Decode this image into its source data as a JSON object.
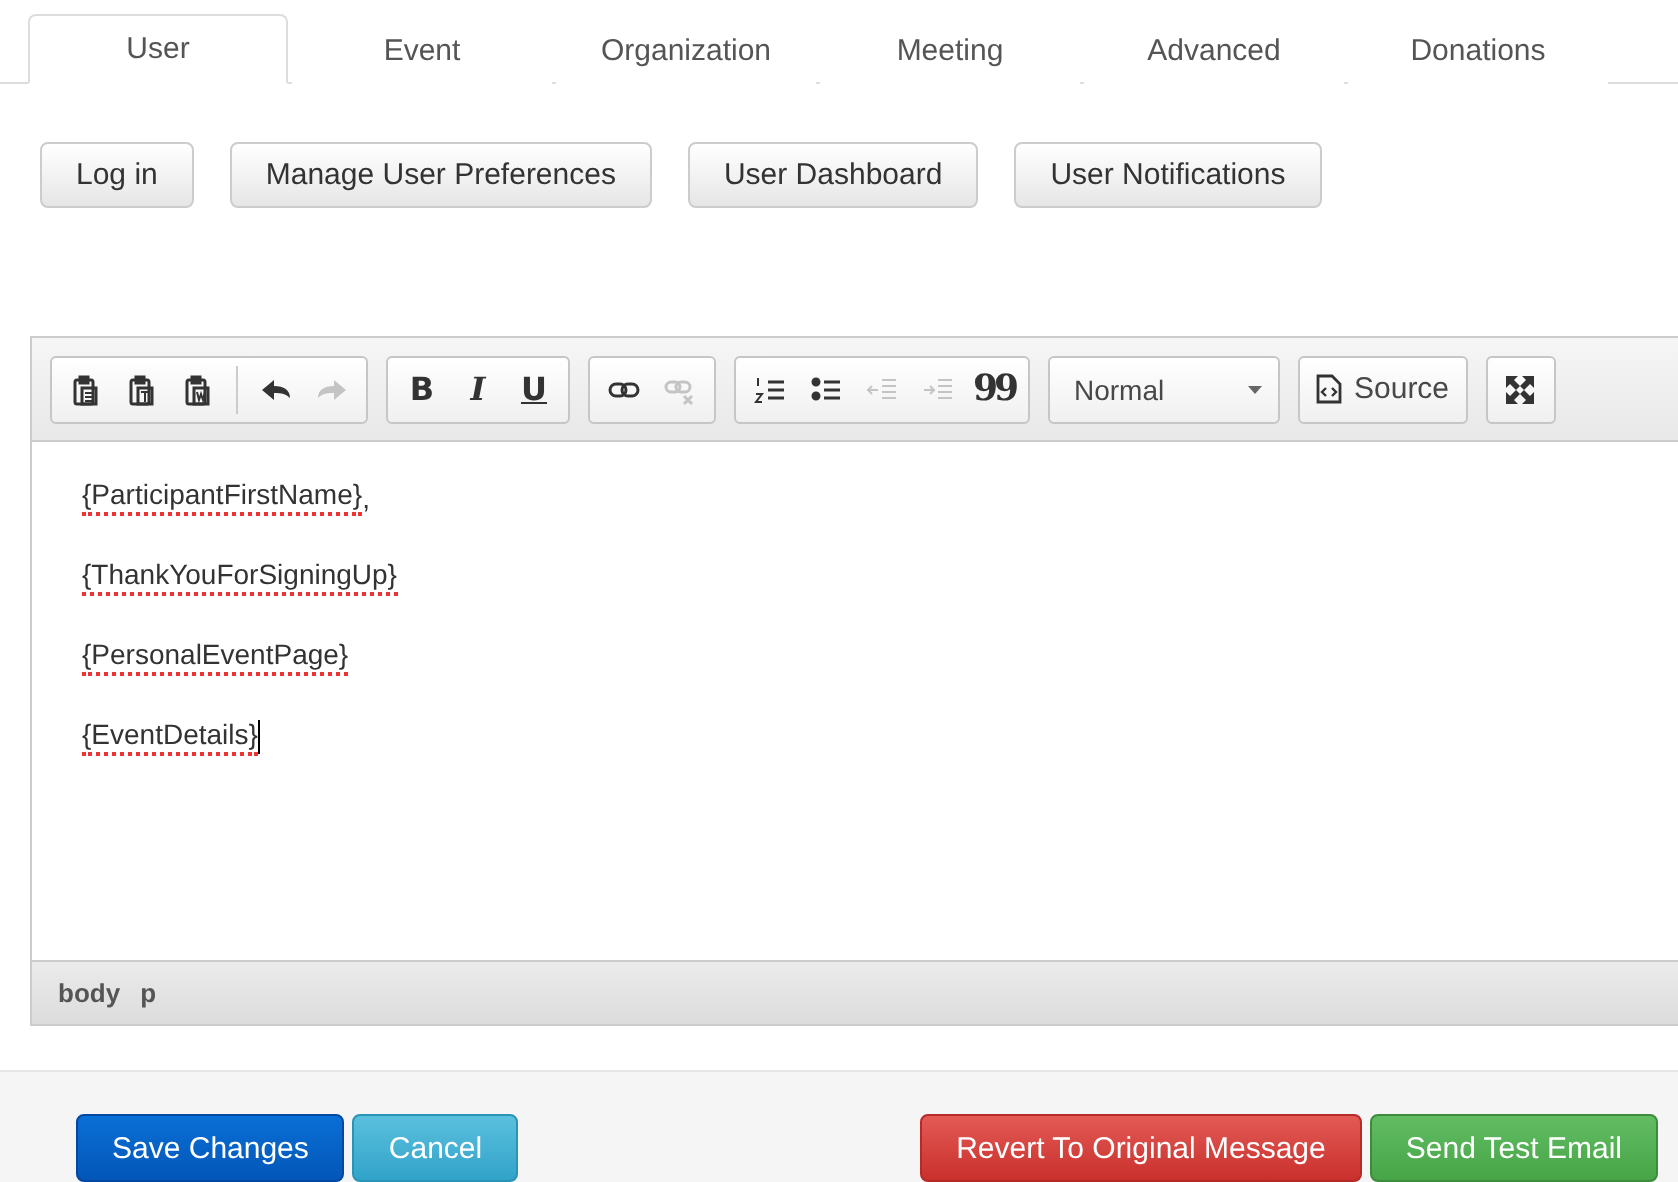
{
  "tabs": [
    {
      "label": "User",
      "selected": true
    },
    {
      "label": "Event",
      "selected": false
    },
    {
      "label": "Organization",
      "selected": false
    },
    {
      "label": "Meeting",
      "selected": false
    },
    {
      "label": "Advanced",
      "selected": false
    },
    {
      "label": "Donations",
      "selected": false
    }
  ],
  "actions": [
    "Log in",
    "Manage User Preferences",
    "User Dashboard",
    "User Notifications"
  ],
  "editor": {
    "toolbar": [
      {
        "tools": [
          {
            "kind": "paste",
            "disabled": false
          },
          {
            "kind": "paste-text",
            "disabled": false
          },
          {
            "kind": "paste-word",
            "disabled": false
          },
          {
            "kind": "separator"
          },
          {
            "kind": "undo",
            "disabled": false
          },
          {
            "kind": "redo",
            "disabled": true
          }
        ]
      },
      {
        "tools": [
          {
            "kind": "bold",
            "label": "B",
            "disabled": false
          },
          {
            "kind": "italic",
            "label": "I",
            "disabled": false
          },
          {
            "kind": "underline",
            "label": "U",
            "disabled": false
          }
        ]
      },
      {
        "tools": [
          {
            "kind": "link",
            "disabled": false
          },
          {
            "kind": "unlink",
            "disabled": true
          }
        ]
      },
      {
        "tools": [
          {
            "kind": "numbered-list",
            "disabled": false
          },
          {
            "kind": "bulleted-list",
            "disabled": false
          },
          {
            "kind": "outdent",
            "disabled": true
          },
          {
            "kind": "indent",
            "disabled": true
          },
          {
            "kind": "quote",
            "label": "99",
            "disabled": false
          }
        ]
      }
    ],
    "format": "Normal",
    "source": "Source",
    "lines": [
      {
        "text": "{ParticipantFirstName}",
        "suffix": ",",
        "misspelled": true,
        "cursor": false
      },
      {
        "text": "{ThankYouForSigningUp}",
        "misspelled": true,
        "cursor": false
      },
      {
        "text": "{PersonalEventPage}",
        "misspelled": true,
        "cursor": false
      },
      {
        "text": "{EventDetails}",
        "misspelled": true,
        "cursor": true
      }
    ],
    "path": [
      "body",
      "p"
    ]
  },
  "footer": [
    {
      "label": "Save Changes",
      "kind": "primary"
    },
    {
      "label": "Cancel",
      "kind": "info"
    },
    {
      "label": "Revert To Original Message",
      "kind": "danger"
    },
    {
      "label": "Send Test Email",
      "kind": "success"
    }
  ]
}
